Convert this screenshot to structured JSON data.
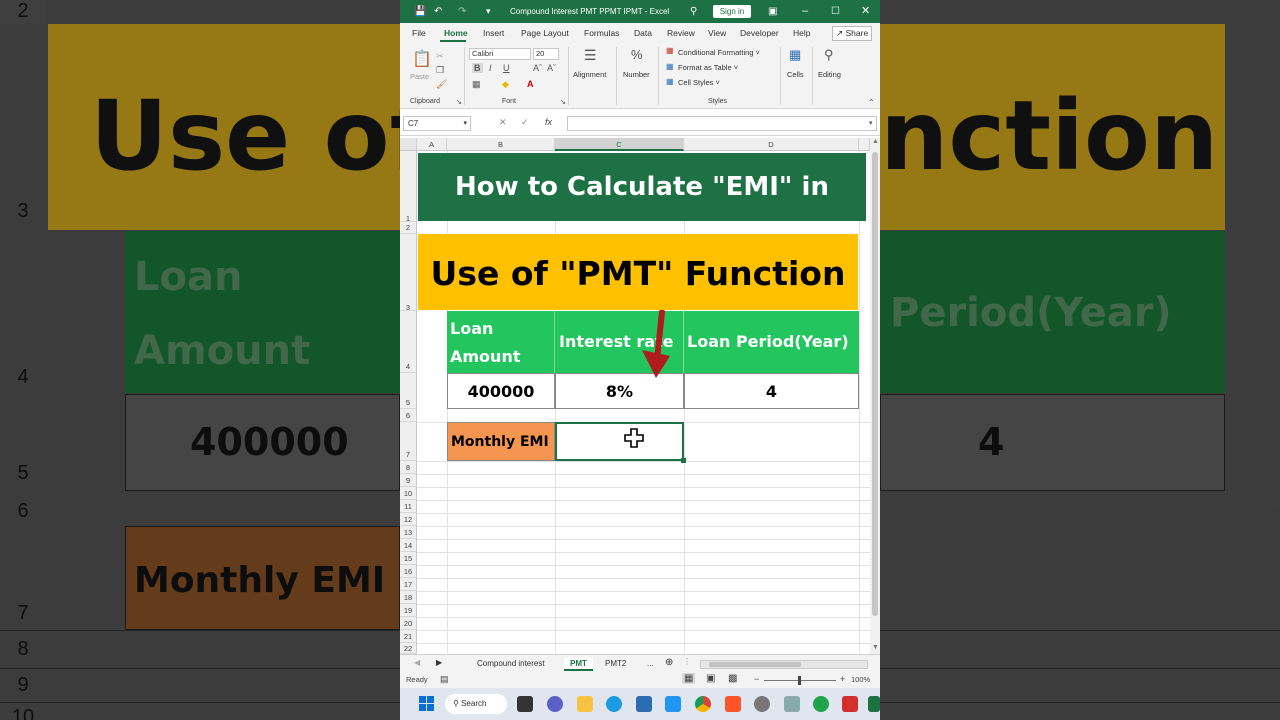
{
  "window": {
    "title": "Compound Interest PMT PPMT IPMT  -  Excel",
    "sign_in": "Sign in",
    "share": "Share"
  },
  "menu": [
    "File",
    "Home",
    "Insert",
    "Page Layout",
    "Formulas",
    "Data",
    "Review",
    "View",
    "Developer",
    "Help"
  ],
  "ribbon": {
    "paste": "Paste",
    "clipboard": "Clipboard",
    "font_name": "Calibri",
    "font_size": "20",
    "font": "Font",
    "alignment": "Alignment",
    "number": "Number",
    "conditional_formatting": "Conditional Formatting ˅",
    "format_as_table": "Format as Table ˅",
    "cell_styles": "Cell Styles ˅",
    "styles": "Styles",
    "cells": "Cells",
    "editing": "Editing"
  },
  "formula_bar": {
    "name_box": "C7",
    "fx": "fx",
    "value": ""
  },
  "columns": [
    "A",
    "B",
    "C",
    "D"
  ],
  "rows": [
    "1",
    "2",
    "3",
    "4",
    "5",
    "6",
    "7",
    "8",
    "9",
    "10",
    "11",
    "12",
    "13",
    "14",
    "15",
    "16",
    "17",
    "18",
    "19",
    "20",
    "21",
    "22"
  ],
  "sheet": {
    "title": "How to Calculate \"EMI\" in Excel",
    "subtitle": "Use of \"PMT\" Function",
    "headers": [
      "Loan Amount",
      "Interest rate",
      "Loan Period(Year)"
    ],
    "header_loan_line1": "Loan",
    "header_loan_line2": "Amount",
    "values": [
      "400000",
      "8%",
      "4"
    ],
    "emi_label": "Monthly EMI",
    "emi_value": ""
  },
  "background": {
    "title_fragment_left": "Use of",
    "title_fragment_right": "nction",
    "loan_line1": "Loan",
    "loan_line2": "Amount",
    "period_fragment": "Period(Year)",
    "loan_value": "400000",
    "period_value": "4",
    "emi": "Monthly EMI",
    "row_numbers": [
      "2",
      "3",
      "4",
      "5",
      "6",
      "7",
      "8",
      "9",
      "10"
    ]
  },
  "sheet_tabs": [
    "Compound interest",
    "PMT",
    "PMT2",
    "..."
  ],
  "active_tab": "PMT",
  "status": {
    "ready": "Ready",
    "zoom": "100%"
  },
  "taskbar": {
    "search": "Search"
  },
  "colors": {
    "excel_green": "#1e7145",
    "title_green": "#1e7145",
    "subtitle_yellow": "#ffc000",
    "header_green": "#22c55e",
    "emi_orange": "#f4964f",
    "arrow_red": "#b01c1c"
  }
}
